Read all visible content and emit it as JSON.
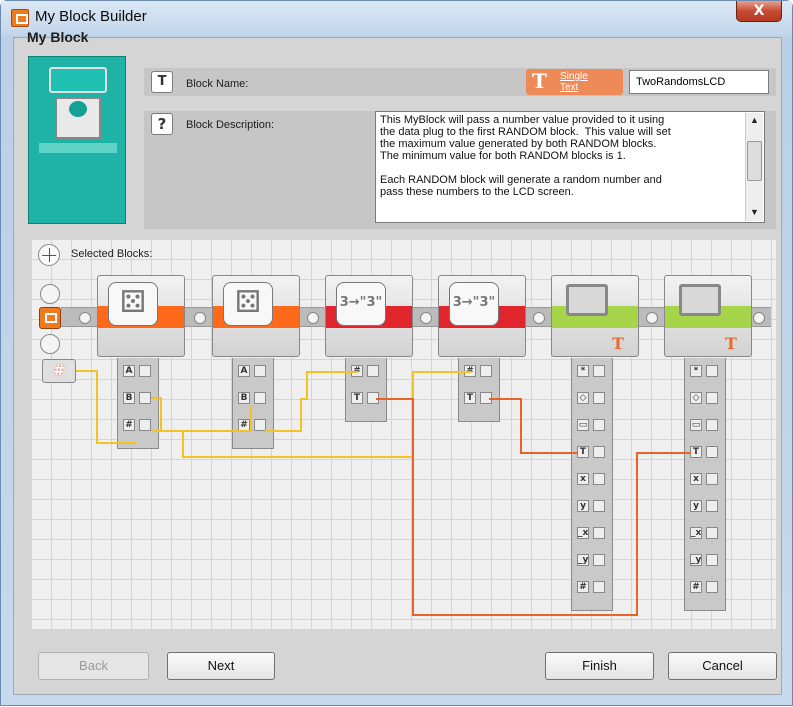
{
  "window": {
    "title": "My Block Builder",
    "close_glyph": "X"
  },
  "header": {
    "section_label": "My Block",
    "block_name_label": "Block Name:",
    "block_description_label": "Block Description:",
    "single_text_label": "Single\nText",
    "block_name_value": "TwoRandomsLCD",
    "block_description_value": "This MyBlock will pass a number value provided to it using\nthe data plug to the first RANDOM block.  This value will set\nthe maximum value generated by both RANDOM blocks.\nThe minimum value for both RANDOM blocks is 1.\n\nEach RANDOM block will generate a random number and\npass these numbers to the LCD screen."
  },
  "canvas": {
    "selected_blocks_label": "Selected Blocks:",
    "number_port_glyph": "#",
    "blocks": [
      {
        "kind": "random",
        "band_color": "#ff6a1a",
        "plugs": [
          "A",
          "B",
          "#"
        ]
      },
      {
        "kind": "random",
        "band_color": "#ff6a1a",
        "plugs": [
          "A",
          "B",
          "#"
        ]
      },
      {
        "kind": "number-to-text",
        "band_color": "#e0262c",
        "glyph": "3→\"3\"",
        "plugs": [
          "#",
          "T"
        ]
      },
      {
        "kind": "number-to-text",
        "band_color": "#e0262c",
        "glyph": "3→\"3\"",
        "plugs": [
          "#",
          "T"
        ]
      },
      {
        "kind": "display",
        "band_color": "#a7d54a",
        "badge": "T",
        "plugs": [
          "*",
          "◇",
          "▭",
          "T",
          "x",
          "y",
          "_x",
          "_y",
          "#"
        ]
      },
      {
        "kind": "display",
        "band_color": "#a7d54a",
        "badge": "T",
        "plugs": [
          "*",
          "◇",
          "▭",
          "T",
          "x",
          "y",
          "_x",
          "_y",
          "#"
        ]
      }
    ]
  },
  "buttons": {
    "back": "Back",
    "next": "Next",
    "finish": "Finish",
    "cancel": "Cancel"
  },
  "colors": {
    "accent": "#f07b1f",
    "number_wire": "#f2c322",
    "text_wire": "#e8622a",
    "canvas_bg": "#efefef"
  }
}
